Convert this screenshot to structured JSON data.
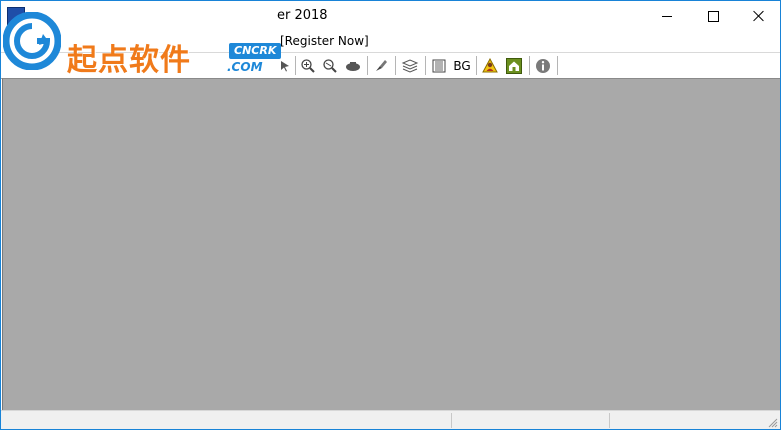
{
  "window": {
    "title": "er 2018",
    "controls": {
      "minimize": "minimize",
      "maximize": "maximize",
      "close": "close"
    }
  },
  "menu": {
    "items": [
      {
        "label": "[Register Now]"
      }
    ]
  },
  "toolbar": {
    "bg_label": "BG",
    "icons": [
      "arrow-icon",
      "zoom-in-icon",
      "zoom-fit-icon",
      "hand-icon",
      "brush-icon",
      "layers-icon",
      "grid-icon",
      "bg-button",
      "user-warning-icon",
      "home-icon",
      "info-icon"
    ]
  },
  "watermark": {
    "text": "起点软件",
    "badge": "CNCRK",
    "domain": ".COM"
  },
  "colors": {
    "client_bg": "#a9a9a9",
    "accent_border": "#1883d7",
    "logo_orange": "#f07a1a",
    "logo_blue": "#1e88d8"
  }
}
